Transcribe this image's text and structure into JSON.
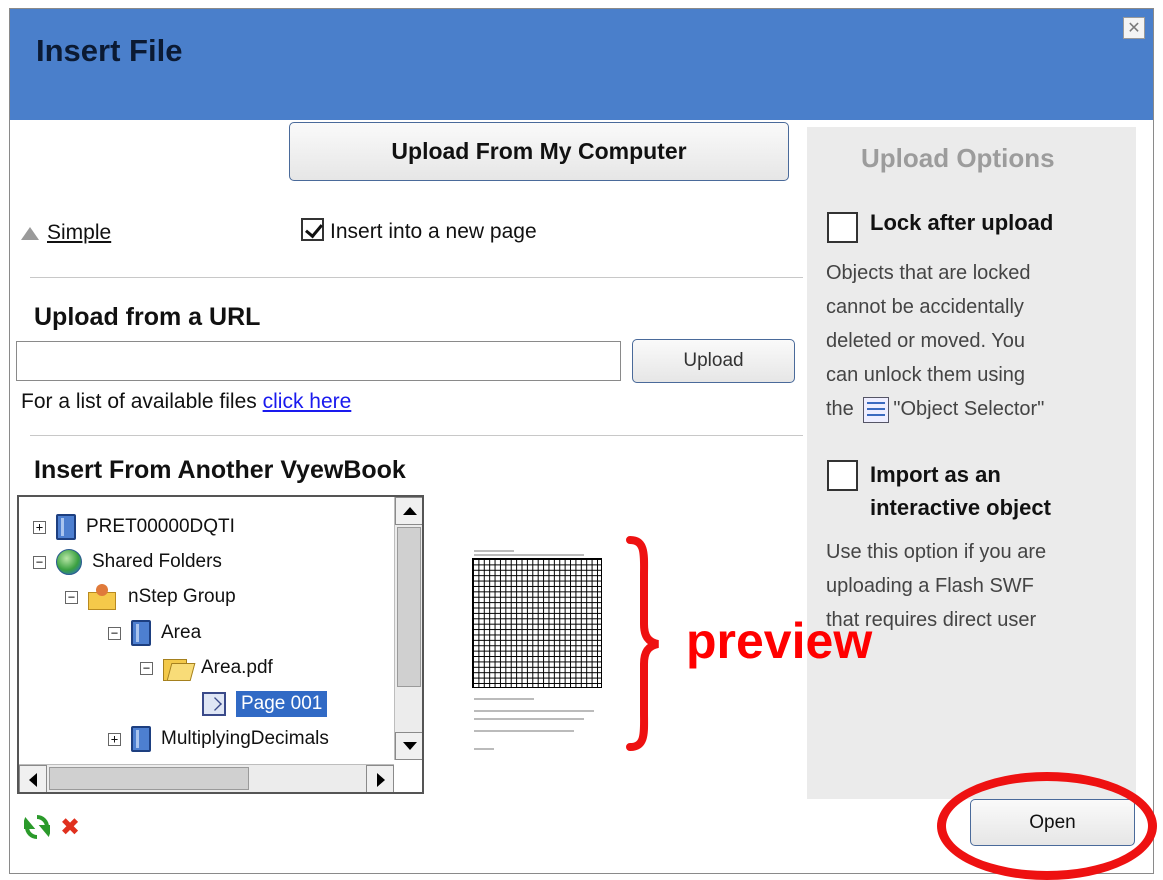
{
  "dialog": {
    "title": "Insert File",
    "close_glyph": "✕"
  },
  "upload": {
    "computer_button": "Upload From My Computer",
    "insert_new_page_label": "Insert into a new page",
    "insert_new_page_checked": true,
    "simple_link": "Simple"
  },
  "url_section": {
    "title": "Upload from a URL",
    "input_value": "",
    "upload_button": "Upload",
    "hint_prefix": "For a list of available files ",
    "hint_link": "click here"
  },
  "vyewbook": {
    "title": "Insert From Another VyewBook",
    "tree": [
      {
        "label": "PRET00000DQTI",
        "toggle": "+",
        "icon": "book-icon",
        "level": 0
      },
      {
        "label": "Shared Folders",
        "toggle": "−",
        "icon": "globe-icon",
        "level": 0
      },
      {
        "label": "nStep Group",
        "toggle": "−",
        "icon": "group-folder-icon",
        "level": 1
      },
      {
        "label": "Area",
        "toggle": "−",
        "icon": "book-icon",
        "level": 2
      },
      {
        "label": "Area.pdf",
        "toggle": "−",
        "icon": "open-folder-icon",
        "level": 3
      },
      {
        "label": "Page 001",
        "toggle": "",
        "icon": "page-icon",
        "level": 4,
        "selected": true
      },
      {
        "label": "MultiplyingDecimals",
        "toggle": "+",
        "icon": "book-icon",
        "level": 2
      }
    ]
  },
  "annotation": {
    "preview_label": "preview",
    "accent_color": "#ff0000"
  },
  "options": {
    "title": "Upload Options",
    "lock_label": "Lock after upload",
    "lock_checked": false,
    "lock_desc_1": "Objects that are locked",
    "lock_desc_2": "cannot be accidentally",
    "lock_desc_3": "deleted or moved.  You",
    "lock_desc_4": "can unlock them using",
    "lock_desc_5_prefix": "the",
    "lock_desc_5_suffix": "\"Object Selector\"",
    "import_label_1": "Import as an",
    "import_label_2": "interactive object",
    "import_checked": false,
    "import_desc_1": "Use this option if you are",
    "import_desc_2": "uploading a Flash SWF",
    "import_desc_3": "that requires direct user"
  },
  "footer": {
    "open_button": "Open",
    "refresh_icon": "refresh-icon",
    "delete_icon": "delete-icon",
    "delete_glyph": "✖"
  },
  "colors": {
    "titlebar": "#4a7fcb",
    "options_panel": "#ebebeb",
    "selection": "#316ac5",
    "annotation_red": "#ee1111"
  }
}
